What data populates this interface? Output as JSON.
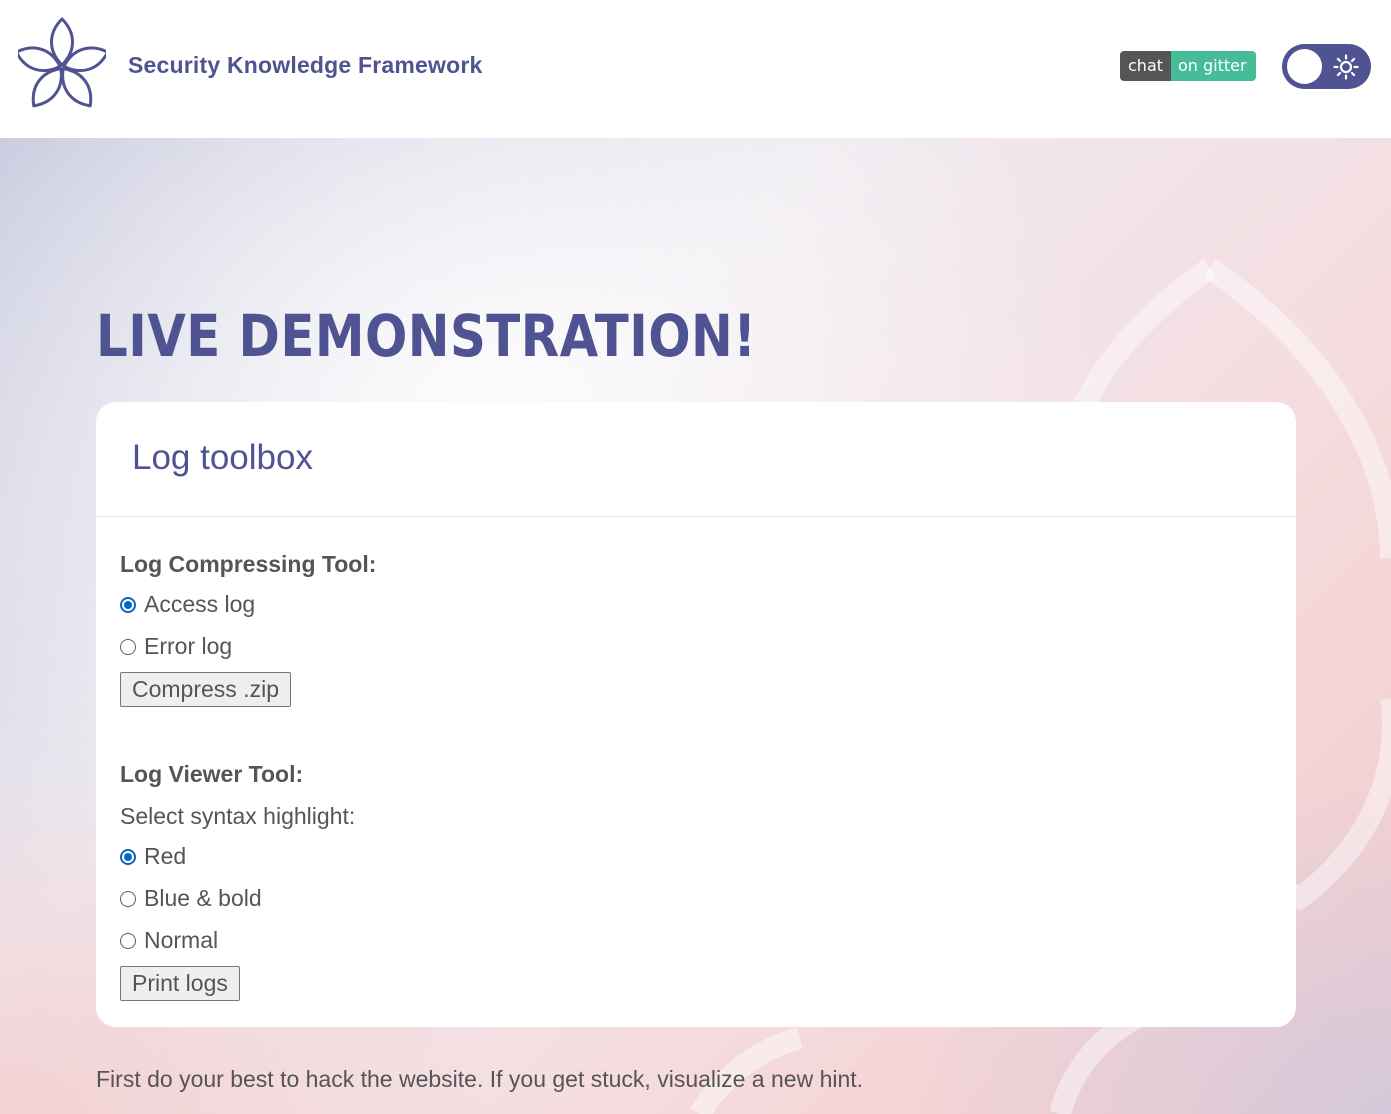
{
  "header": {
    "brand": "Security Knowledge Framework",
    "gitter_badge": {
      "left": "chat",
      "right": "on gitter"
    },
    "theme_toggle": {
      "icon": "sun-icon",
      "state": "light"
    }
  },
  "hero": {
    "title": "LIVE DEMONSTRATION!"
  },
  "card": {
    "title": "Log toolbox",
    "compress_section": {
      "label": "Log Compressing Tool:",
      "options": [
        {
          "label": "Access log",
          "checked": true
        },
        {
          "label": "Error log",
          "checked": false
        }
      ],
      "button": "Compress .zip"
    },
    "viewer_section": {
      "label": "Log Viewer Tool:",
      "prompt": "Select syntax highlight:",
      "options": [
        {
          "label": "Red",
          "checked": true
        },
        {
          "label": "Blue & bold",
          "checked": false
        },
        {
          "label": "Normal",
          "checked": false
        }
      ],
      "button": "Print logs"
    }
  },
  "footer": {
    "hint_text": "First do your best to hack the website. If you get stuck, visualize a new hint."
  },
  "colors": {
    "brand": "#4f5391",
    "text": "#555555",
    "radio_checked": "#0a66c2",
    "gitter_left": "#555555",
    "gitter_right": "#46bc99"
  }
}
